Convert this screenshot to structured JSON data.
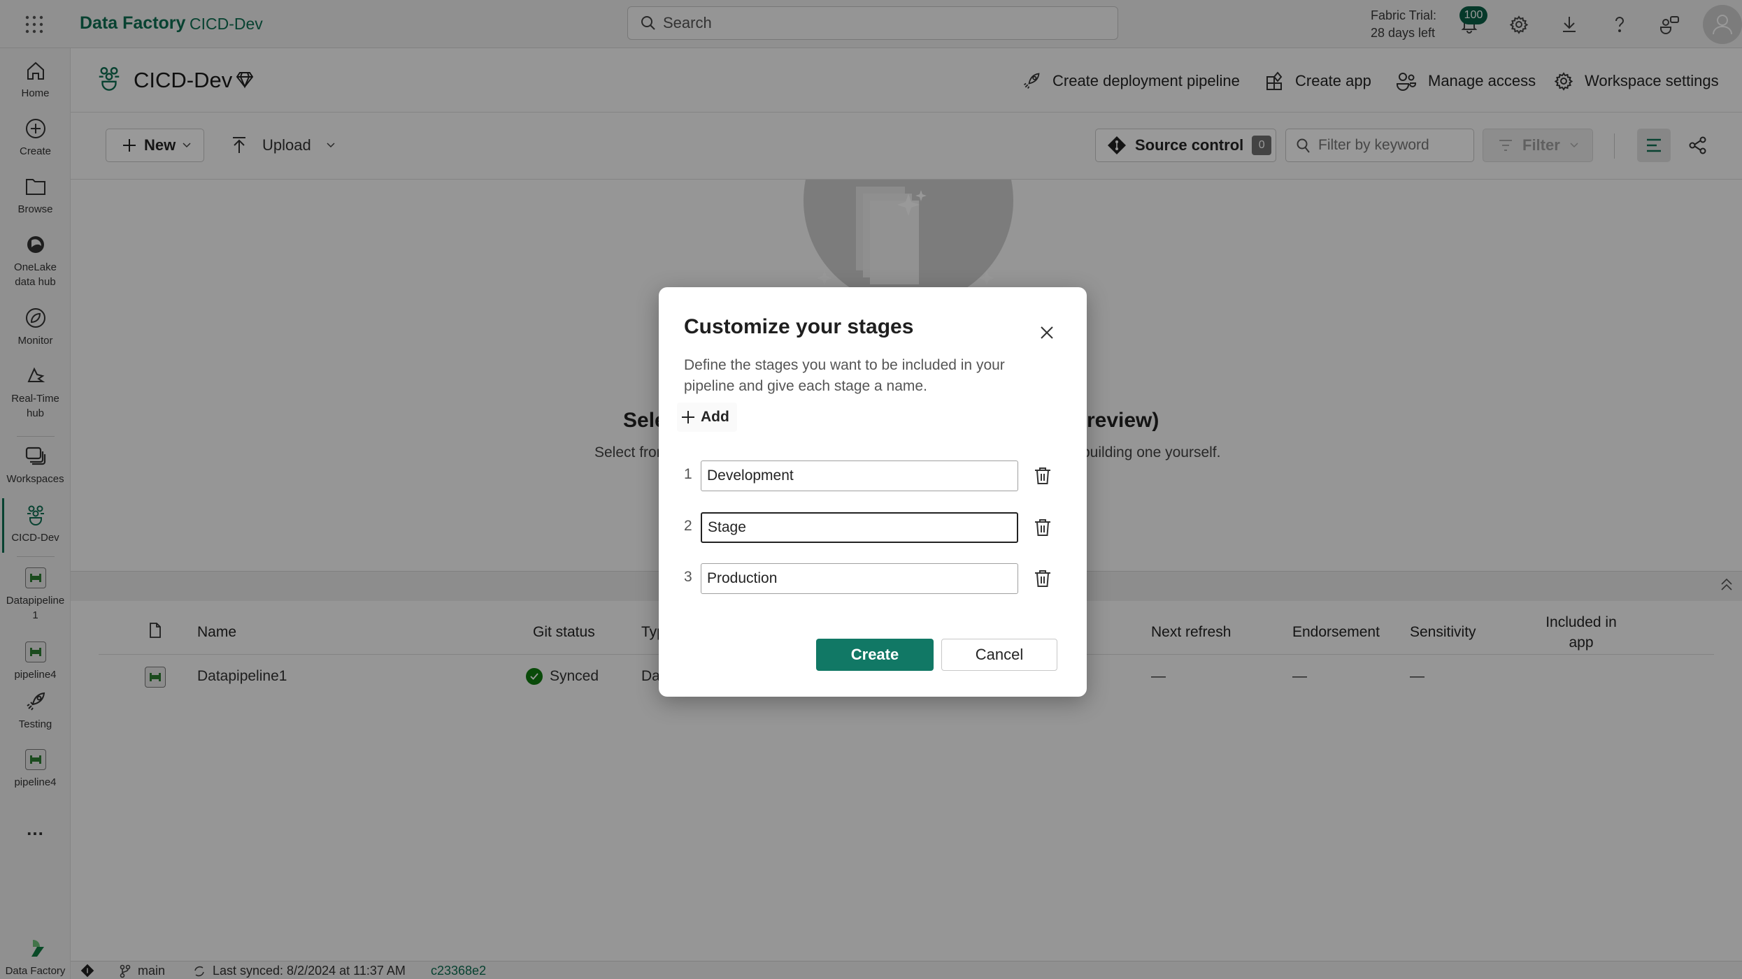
{
  "topbar": {
    "app_name": "Data Factory",
    "workspace_crumb": "CICD-Dev",
    "search_placeholder": "Search",
    "trial_line1": "Fabric Trial:",
    "trial_line2": "28 days left",
    "notification_count": "100",
    "icons": [
      "app-launcher-icon",
      "bell-icon",
      "gear-icon",
      "download-icon",
      "help-icon",
      "feedback-icon",
      "account-icon"
    ],
    "accent_color": "#0e6e52"
  },
  "leftnav": {
    "items": [
      {
        "label": "Home",
        "icon": "home-icon"
      },
      {
        "label": "Create",
        "icon": "plus-circle-icon"
      },
      {
        "label": "Browse",
        "icon": "folder-icon"
      },
      {
        "label": "OneLake data hub",
        "icon": "onelake-icon"
      },
      {
        "label": "Monitor",
        "icon": "monitor-icon"
      },
      {
        "label": "Real-Time hub",
        "icon": "realtime-hub-icon"
      },
      {
        "label": "Workspaces",
        "icon": "workspaces-icon"
      },
      {
        "label": "CICD-Dev",
        "icon": "workspace-people-icon",
        "active": true
      },
      {
        "label": "Datapipeline 1",
        "icon": "pipeline-icon"
      },
      {
        "label": "pipeline4",
        "icon": "pipeline-icon"
      },
      {
        "label": "Testing",
        "icon": "rocket-icon"
      },
      {
        "label": "pipeline4",
        "icon": "pipeline-icon"
      }
    ],
    "more_label": "...",
    "footer_label": "Data Factory"
  },
  "workspace": {
    "title": "CICD-Dev",
    "actions": [
      {
        "label": "Create deployment pipeline",
        "icon": "rocket-icon"
      },
      {
        "label": "Create app",
        "icon": "app-icon"
      },
      {
        "label": "Manage access",
        "icon": "people-icon"
      },
      {
        "label": "Workspace settings",
        "icon": "gear-icon"
      }
    ]
  },
  "commandbar": {
    "new_label": "New",
    "upload_label": "Upload",
    "source_control_label": "Source control",
    "source_control_count": "0",
    "filter_placeholder": "Filter by keyword",
    "filter_label": "Filter"
  },
  "hero": {
    "title_left": "Sele",
    "title_right": "d (preview)",
    "sub_left": "Select fron",
    "sub_right": "building one yourself."
  },
  "table": {
    "columns": [
      "Name",
      "Git status",
      "Typ",
      "Next refresh",
      "Endorsement",
      "Sensitivity",
      "Included in app"
    ],
    "rows": [
      {
        "name": "Datapipeline1",
        "git_status": "Synced",
        "type": "Da",
        "next_refresh": "—",
        "endorsement": "—",
        "sensitivity": "—",
        "included_in_app": ""
      }
    ]
  },
  "statusbar": {
    "branch": "main",
    "last_synced": "Last synced: 8/2/2024 at 11:37 AM",
    "commit": "c23368e2"
  },
  "dialog": {
    "title": "Customize your stages",
    "description": "Define the stages you want to be included in your pipeline and give each stage a name.",
    "add_label": "Add",
    "stages": [
      {
        "number": "1",
        "value": "Development"
      },
      {
        "number": "2",
        "value": "Stage",
        "focused": true
      },
      {
        "number": "3",
        "value": "Production"
      }
    ],
    "create_label": "Create",
    "cancel_label": "Cancel",
    "primary_color": "#117865"
  }
}
